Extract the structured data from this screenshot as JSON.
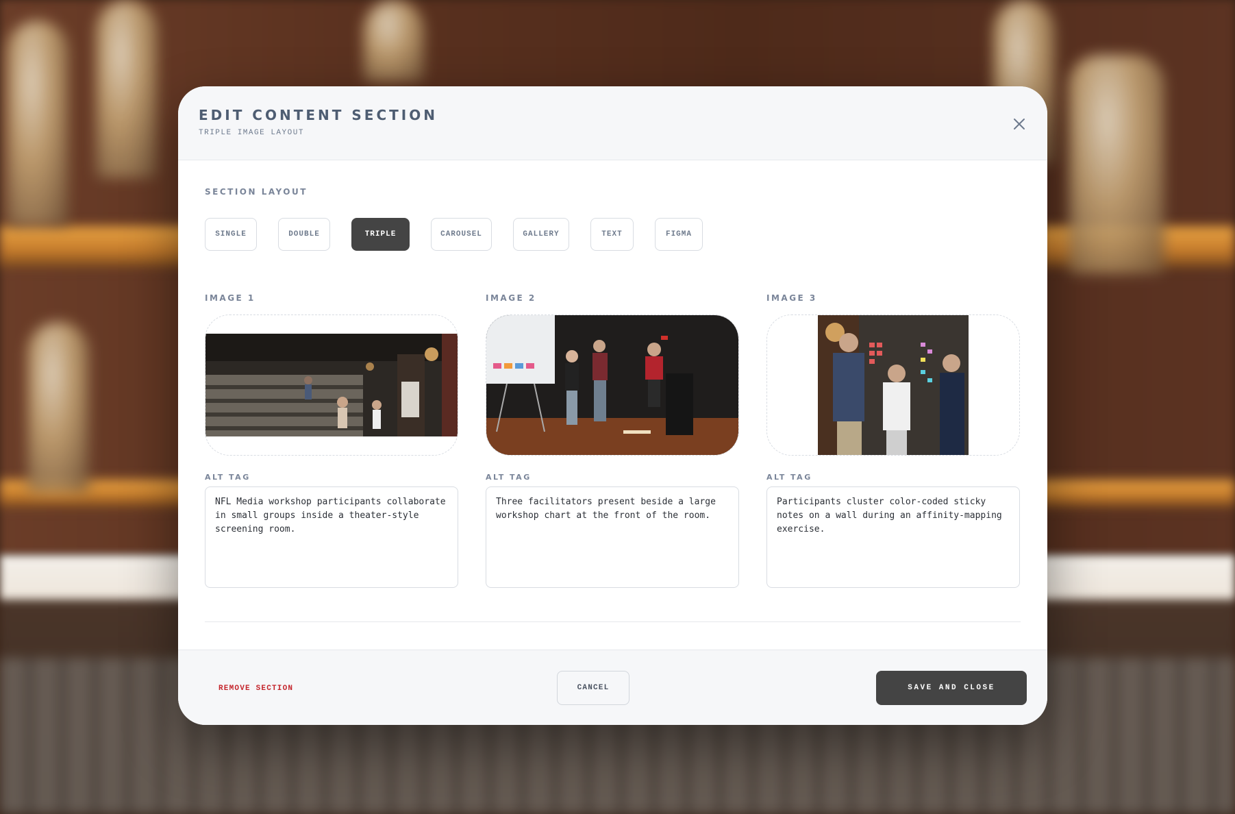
{
  "modal": {
    "title": "EDIT CONTENT SECTION",
    "subtitle": "TRIPLE IMAGE LAYOUT",
    "close_icon": "close-icon"
  },
  "layout": {
    "label": "SECTION LAYOUT",
    "options": [
      "SINGLE",
      "DOUBLE",
      "TRIPLE",
      "CAROUSEL",
      "GALLERY",
      "TEXT",
      "FIGMA"
    ],
    "selected": "TRIPLE"
  },
  "images": [
    {
      "label": "IMAGE 1",
      "alt_label": "ALT TAG",
      "alt_text": "NFL Media workshop participants collaborate in small groups inside a theater-style screening room."
    },
    {
      "label": "IMAGE 2",
      "alt_label": "ALT TAG",
      "alt_text": "Three facilitators present beside a large workshop chart at the front of the room."
    },
    {
      "label": "IMAGE 3",
      "alt_label": "ALT TAG",
      "alt_text": "Participants cluster color-coded sticky notes on a wall during an affinity-mapping exercise."
    }
  ],
  "footer": {
    "remove_label": "REMOVE SECTION",
    "cancel_label": "CANCEL",
    "save_label": "SAVE AND CLOSE"
  },
  "colors": {
    "primary_button": "#444444",
    "danger_text": "#c4242b",
    "heading_text": "#4e5d72"
  }
}
